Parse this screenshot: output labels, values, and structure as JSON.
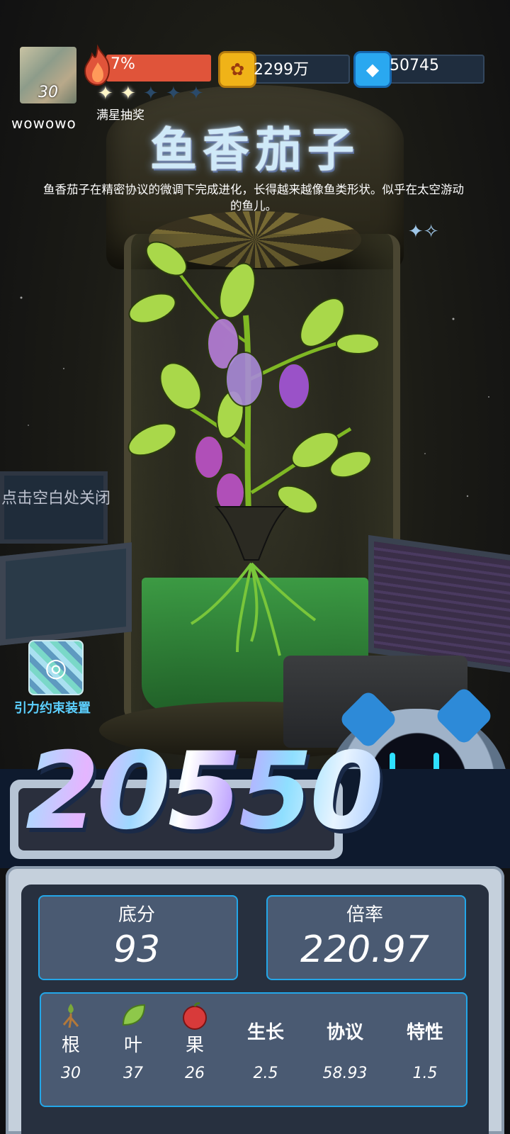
{
  "player": {
    "level": "30",
    "username": "wowowo",
    "progress_text": "7%",
    "progress_fraction": 0.07,
    "stars_filled": 2,
    "stars_total": 5,
    "star_label": "满星抽奖"
  },
  "currencies": [
    {
      "icon": "gold-coin-icon",
      "value": "2299万"
    },
    {
      "icon": "blue-gem-icon",
      "value": "50745"
    }
  ],
  "plant": {
    "name": "鱼香茄子",
    "description": "鱼香茄子在精密协议的微调下完成进化，长得越来越像鱼类形状。似乎在太空游动的鱼儿。"
  },
  "close_hint": "点击空白处关闭",
  "gravity_device": {
    "icon": "orbit-icon",
    "label": "引力约束装置"
  },
  "score": {
    "total": "20550",
    "base_label": "底分",
    "base_value": "93",
    "multiplier_label": "倍率",
    "multiplier_value": "220.97"
  },
  "attributes": [
    {
      "label": "根",
      "value": "30",
      "icon": "root-icon"
    },
    {
      "label": "叶",
      "value": "37",
      "icon": "leaf-icon"
    },
    {
      "label": "果",
      "value": "26",
      "icon": "fruit-icon"
    },
    {
      "label": "生长",
      "value": "2.5"
    },
    {
      "label": "协议",
      "value": "58.93"
    },
    {
      "label": "特性",
      "value": "1.5"
    }
  ],
  "colors": {
    "progress_fill": "#e0543a",
    "stat_border": "#23a6e8",
    "gravity_label": "#5cd0ff"
  }
}
